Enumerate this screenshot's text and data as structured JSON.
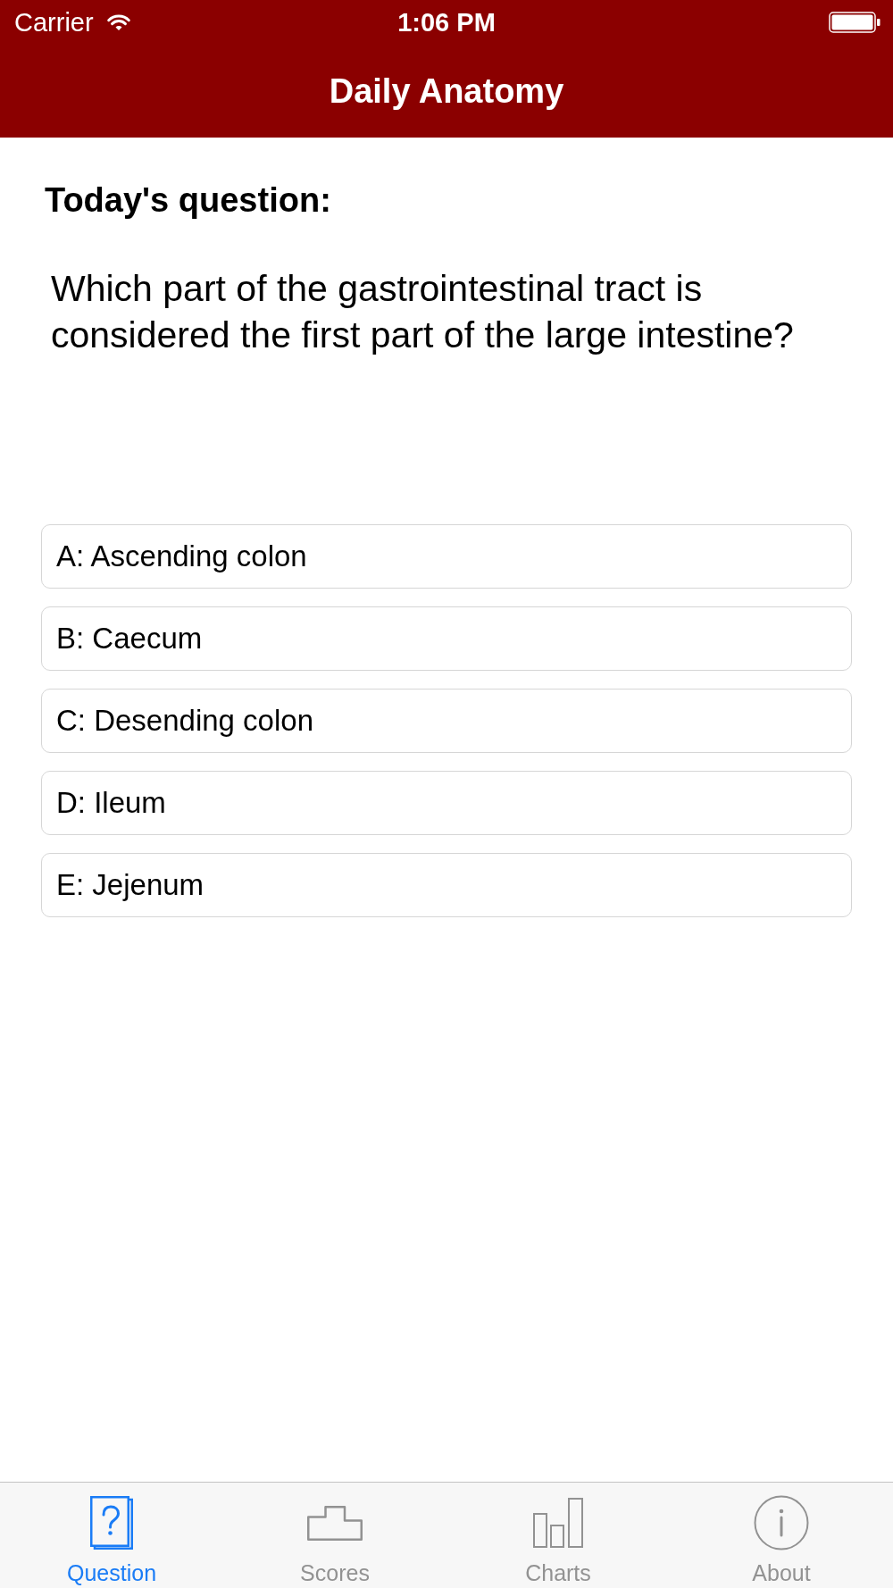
{
  "status_bar": {
    "carrier": "Carrier",
    "time": "1:06 PM"
  },
  "nav_bar": {
    "title": "Daily Anatomy"
  },
  "question": {
    "heading": "Today's question:",
    "text": "Which part of the gastrointestinal tract is considered the first part of the large intestine?"
  },
  "answers": [
    {
      "label": "A: Ascending colon"
    },
    {
      "label": "B: Caecum"
    },
    {
      "label": "C: Desending colon"
    },
    {
      "label": "D: Ileum"
    },
    {
      "label": "E: Jejenum"
    }
  ],
  "tab_bar": [
    {
      "label": "Question",
      "kind": "question",
      "selected": true
    },
    {
      "label": "Scores",
      "kind": "scores",
      "selected": false
    },
    {
      "label": "Charts",
      "kind": "charts",
      "selected": false
    },
    {
      "label": "About",
      "kind": "about",
      "selected": false
    }
  ]
}
